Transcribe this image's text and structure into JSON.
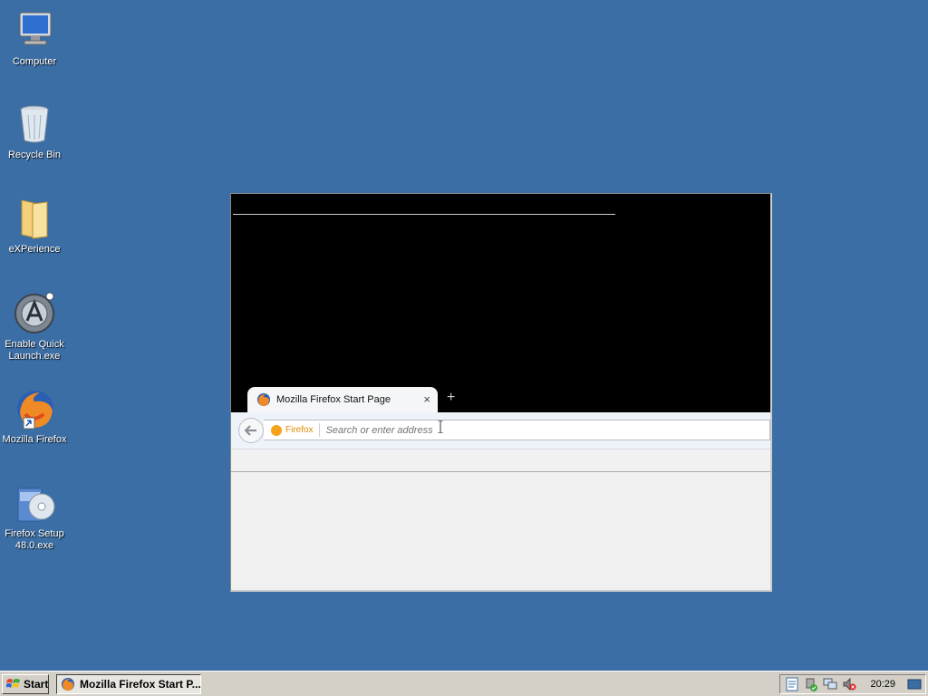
{
  "desktop": {
    "icons": [
      {
        "label": "Computer",
        "icon": "computer-icon"
      },
      {
        "label": "Recycle Bin",
        "icon": "recycle-bin-icon"
      },
      {
        "label": "eXPerience",
        "icon": "folder-icon"
      },
      {
        "label": "Enable Quick Launch.exe",
        "icon": "quick-launch-icon"
      },
      {
        "label": "Mozilla Firefox",
        "icon": "firefox-icon"
      },
      {
        "label": "Firefox Setup 48.0.exe",
        "icon": "setup-icon"
      }
    ]
  },
  "firefox": {
    "tab_title": "Mozilla Firefox Start Page",
    "tab_close": "×",
    "new_tab": "+",
    "identity_label": "Firefox",
    "url_placeholder": "Search or enter address"
  },
  "taskbar": {
    "start_label": "Start",
    "task_label": "Mozilla Firefox Start P...",
    "clock": "20:29"
  },
  "colors": {
    "desktop": "#3a6ea5",
    "taskbar": "#d4d0c8",
    "firefox_orange": "#f7a21b"
  }
}
